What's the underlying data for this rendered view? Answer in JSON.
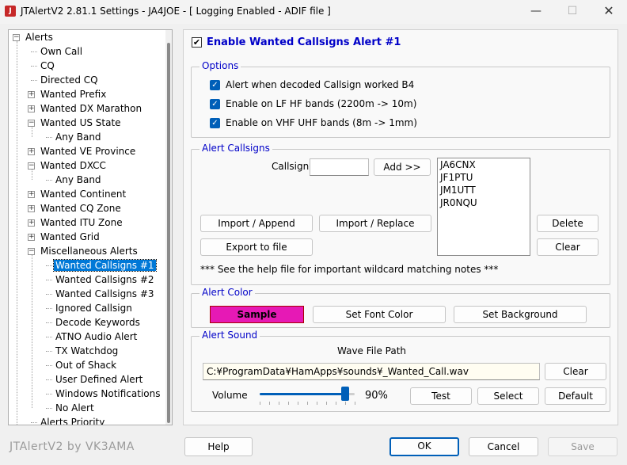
{
  "window": {
    "title": "JTAlertV2  2.81.1 Settings  -  JA4JOE  -  [ Logging Enabled - ADIF file ]",
    "app_icon": "J",
    "controls": {
      "minimize": "—",
      "maximize": "☐",
      "close": "✕"
    }
  },
  "tree": {
    "items": [
      {
        "label": "Alerts",
        "level": 0,
        "expander": "−"
      },
      {
        "label": "Own Call",
        "level": 1,
        "expander": ""
      },
      {
        "label": "CQ",
        "level": 1,
        "expander": ""
      },
      {
        "label": "Directed CQ",
        "level": 1,
        "expander": ""
      },
      {
        "label": "Wanted Prefix",
        "level": 1,
        "expander": "+"
      },
      {
        "label": "Wanted DX Marathon",
        "level": 1,
        "expander": "+"
      },
      {
        "label": "Wanted US State",
        "level": 1,
        "expander": "−"
      },
      {
        "label": "Any Band",
        "level": 2,
        "expander": ""
      },
      {
        "label": "Wanted VE Province",
        "level": 1,
        "expander": "+"
      },
      {
        "label": "Wanted DXCC",
        "level": 1,
        "expander": "−"
      },
      {
        "label": "Any Band",
        "level": 2,
        "expander": ""
      },
      {
        "label": "Wanted Continent",
        "level": 1,
        "expander": "+"
      },
      {
        "label": "Wanted CQ Zone",
        "level": 1,
        "expander": "+"
      },
      {
        "label": "Wanted ITU Zone",
        "level": 1,
        "expander": "+"
      },
      {
        "label": "Wanted Grid",
        "level": 1,
        "expander": "+"
      },
      {
        "label": "Miscellaneous Alerts",
        "level": 1,
        "expander": "−"
      },
      {
        "label": "Wanted Callsigns #1",
        "level": 2,
        "expander": "",
        "selected": true
      },
      {
        "label": "Wanted Callsigns #2",
        "level": 2,
        "expander": ""
      },
      {
        "label": "Wanted Callsigns #3",
        "level": 2,
        "expander": ""
      },
      {
        "label": "Ignored Callsign",
        "level": 2,
        "expander": ""
      },
      {
        "label": "Decode Keywords",
        "level": 2,
        "expander": ""
      },
      {
        "label": "ATNO Audio Alert",
        "level": 2,
        "expander": ""
      },
      {
        "label": "TX Watchdog",
        "level": 2,
        "expander": ""
      },
      {
        "label": "Out of Shack",
        "level": 2,
        "expander": ""
      },
      {
        "label": "User Defined Alert",
        "level": 2,
        "expander": ""
      },
      {
        "label": "Windows Notifications",
        "level": 2,
        "expander": ""
      },
      {
        "label": "No Alert",
        "level": 2,
        "expander": ""
      },
      {
        "label": "Alerts Priority",
        "level": 1,
        "expander": ""
      }
    ]
  },
  "panel": {
    "enable_label": "Enable Wanted Callsigns Alert #1",
    "enable_checked": true,
    "options": {
      "title": "Options",
      "items": [
        {
          "label": "Alert when decoded Callsign worked B4",
          "checked": true
        },
        {
          "label": "Enable on LF  HF bands (2200m -> 10m)",
          "checked": true
        },
        {
          "label": "Enable on VHF  UHF bands (8m -> 1mm)",
          "checked": true
        }
      ]
    },
    "alert_callsigns": {
      "title": "Alert Callsigns",
      "callsign_label": "Callsign",
      "callsign_value": "",
      "add_label": "Add >>",
      "callsigns": [
        "JA6CNX",
        "JF1PTU",
        "JM1UTT",
        "JR0NQU"
      ],
      "import_append": "Import / Append",
      "import_replace": "Import / Replace",
      "export": "Export to file",
      "delete": "Delete",
      "clear": "Clear",
      "note": "***  See the help file for important wildcard matching notes  ***"
    },
    "alert_color": {
      "title": "Alert Color",
      "sample": "Sample",
      "sample_color": "#e619b5",
      "set_font": "Set Font Color",
      "set_background": "Set Background"
    },
    "alert_sound": {
      "title": "Alert Sound",
      "path_label": "Wave File Path",
      "path": "C:¥ProgramData¥HamApps¥sounds¥_Wanted_Call.wav",
      "clear": "Clear",
      "volume_label": "Volume",
      "volume_percent": "90%",
      "volume_value": 90,
      "test": "Test",
      "select": "Select",
      "default": "Default"
    }
  },
  "footer": {
    "brand": "JTAlertV2 by VK3AMA",
    "help": "Help",
    "ok": "OK",
    "cancel": "Cancel",
    "save": "Save"
  },
  "colors": {
    "accent": "#005fb8",
    "group_title": "#0000c8",
    "selection": "#0078d7"
  }
}
